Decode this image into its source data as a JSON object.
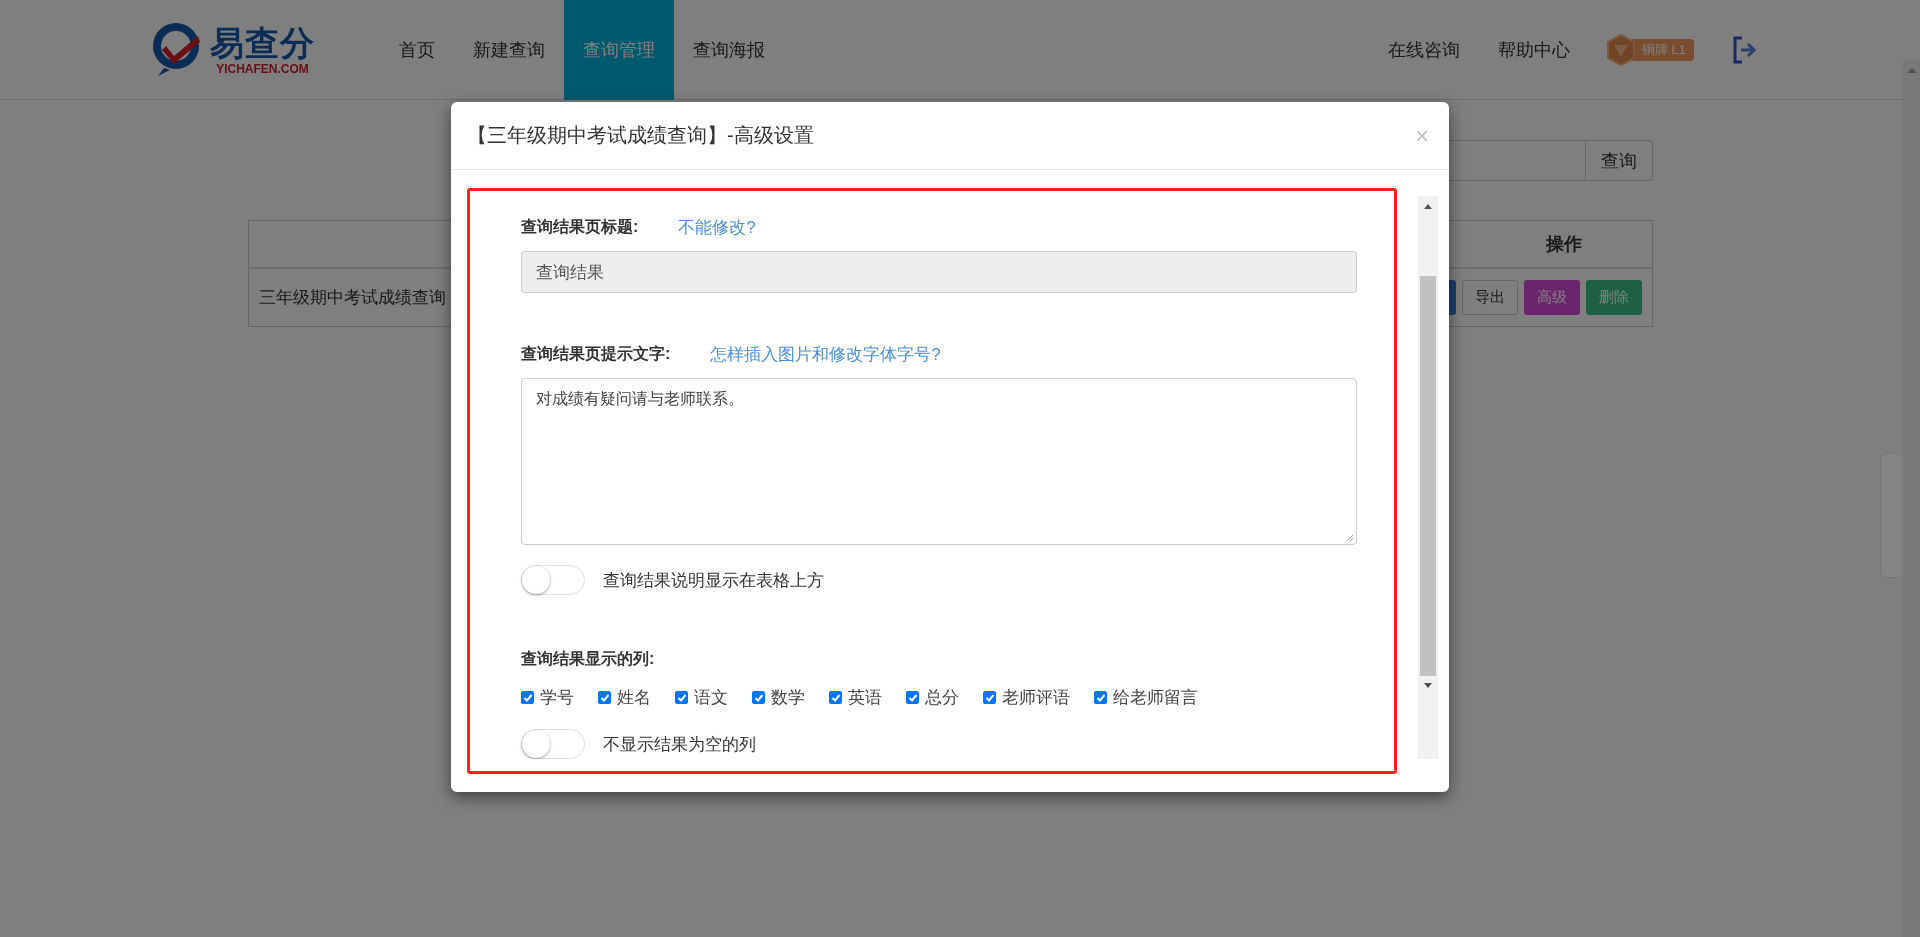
{
  "header": {
    "logo": {
      "brand": "易查分",
      "domain": "YICHAFEN.COM"
    },
    "nav": [
      {
        "label": "首页",
        "selected": false
      },
      {
        "label": "新建查询",
        "selected": false
      },
      {
        "label": "查询管理",
        "selected": true
      },
      {
        "label": "查询海报",
        "selected": false
      }
    ],
    "links": [
      "在线咨询",
      "帮助中心"
    ],
    "badge": "铜牌 L1"
  },
  "page": {
    "search_button": "查询",
    "table": {
      "action_column": "操作",
      "rows": [
        {
          "name": "三年级期中考试成绩查询",
          "actions": [
            {
              "kind": "edit"
            },
            {
              "kind": "export",
              "label": "导出"
            },
            {
              "kind": "advanced",
              "label": "高级"
            },
            {
              "kind": "delete",
              "label": "删除"
            }
          ]
        }
      ]
    }
  },
  "modal": {
    "title": "【三年级期中考试成绩查询】-高级设置",
    "close": "×",
    "title_field": {
      "label": "查询结果页标题:",
      "help_link": "不能修改?",
      "value": "查询结果",
      "disabled": true
    },
    "tip_field": {
      "label": "查询结果页提示文字:",
      "help_link": "怎样插入图片和修改字体字号?",
      "value": "对成绩有疑问请与老师联系。"
    },
    "show_above": {
      "label": "查询结果说明显示在表格上方",
      "on": false
    },
    "columns": {
      "label": "查询结果显示的列:",
      "options": [
        {
          "label": "学号",
          "checked": true
        },
        {
          "label": "姓名",
          "checked": true
        },
        {
          "label": "语文",
          "checked": true
        },
        {
          "label": "数学",
          "checked": true
        },
        {
          "label": "英语",
          "checked": true
        },
        {
          "label": "总分",
          "checked": true
        },
        {
          "label": "老师评语",
          "checked": true
        },
        {
          "label": "给老师留言",
          "checked": true
        }
      ]
    },
    "hide_empty": {
      "label": "不显示结果为空的列",
      "on": false
    }
  }
}
